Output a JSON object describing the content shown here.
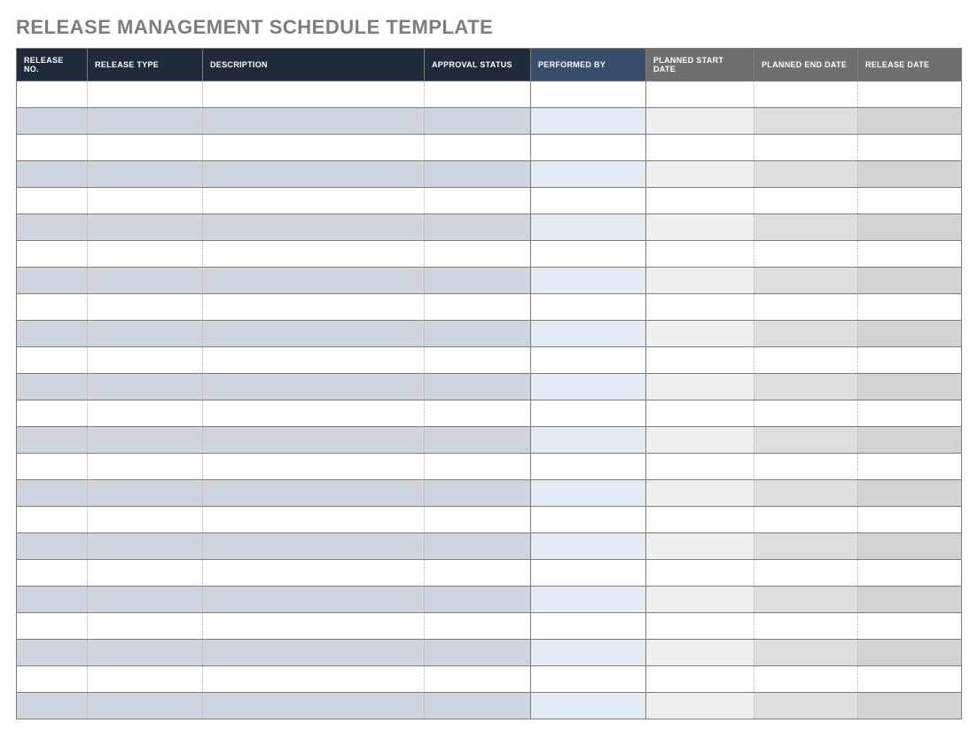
{
  "title": "RELEASE MANAGEMENT SCHEDULE TEMPLATE",
  "columns": [
    "RELEASE NO.",
    "RELEASE TYPE",
    "DESCRIPTION",
    "APPROVAL STATUS",
    "PERFORMED BY",
    "PLANNED START DATE",
    "PLANNED END DATE",
    "RELEASE DATE"
  ],
  "row_count": 24,
  "rows": [
    {
      "release_no": "",
      "release_type": "",
      "description": "",
      "approval_status": "",
      "performed_by": "",
      "planned_start_date": "",
      "planned_end_date": "",
      "release_date": ""
    },
    {
      "release_no": "",
      "release_type": "",
      "description": "",
      "approval_status": "",
      "performed_by": "",
      "planned_start_date": "",
      "planned_end_date": "",
      "release_date": ""
    },
    {
      "release_no": "",
      "release_type": "",
      "description": "",
      "approval_status": "",
      "performed_by": "",
      "planned_start_date": "",
      "planned_end_date": "",
      "release_date": ""
    },
    {
      "release_no": "",
      "release_type": "",
      "description": "",
      "approval_status": "",
      "performed_by": "",
      "planned_start_date": "",
      "planned_end_date": "",
      "release_date": ""
    },
    {
      "release_no": "",
      "release_type": "",
      "description": "",
      "approval_status": "",
      "performed_by": "",
      "planned_start_date": "",
      "planned_end_date": "",
      "release_date": ""
    },
    {
      "release_no": "",
      "release_type": "",
      "description": "",
      "approval_status": "",
      "performed_by": "",
      "planned_start_date": "",
      "planned_end_date": "",
      "release_date": ""
    },
    {
      "release_no": "",
      "release_type": "",
      "description": "",
      "approval_status": "",
      "performed_by": "",
      "planned_start_date": "",
      "planned_end_date": "",
      "release_date": ""
    },
    {
      "release_no": "",
      "release_type": "",
      "description": "",
      "approval_status": "",
      "performed_by": "",
      "planned_start_date": "",
      "planned_end_date": "",
      "release_date": ""
    },
    {
      "release_no": "",
      "release_type": "",
      "description": "",
      "approval_status": "",
      "performed_by": "",
      "planned_start_date": "",
      "planned_end_date": "",
      "release_date": ""
    },
    {
      "release_no": "",
      "release_type": "",
      "description": "",
      "approval_status": "",
      "performed_by": "",
      "planned_start_date": "",
      "planned_end_date": "",
      "release_date": ""
    },
    {
      "release_no": "",
      "release_type": "",
      "description": "",
      "approval_status": "",
      "performed_by": "",
      "planned_start_date": "",
      "planned_end_date": "",
      "release_date": ""
    },
    {
      "release_no": "",
      "release_type": "",
      "description": "",
      "approval_status": "",
      "performed_by": "",
      "planned_start_date": "",
      "planned_end_date": "",
      "release_date": ""
    },
    {
      "release_no": "",
      "release_type": "",
      "description": "",
      "approval_status": "",
      "performed_by": "",
      "planned_start_date": "",
      "planned_end_date": "",
      "release_date": ""
    },
    {
      "release_no": "",
      "release_type": "",
      "description": "",
      "approval_status": "",
      "performed_by": "",
      "planned_start_date": "",
      "planned_end_date": "",
      "release_date": ""
    },
    {
      "release_no": "",
      "release_type": "",
      "description": "",
      "approval_status": "",
      "performed_by": "",
      "planned_start_date": "",
      "planned_end_date": "",
      "release_date": ""
    },
    {
      "release_no": "",
      "release_type": "",
      "description": "",
      "approval_status": "",
      "performed_by": "",
      "planned_start_date": "",
      "planned_end_date": "",
      "release_date": ""
    },
    {
      "release_no": "",
      "release_type": "",
      "description": "",
      "approval_status": "",
      "performed_by": "",
      "planned_start_date": "",
      "planned_end_date": "",
      "release_date": ""
    },
    {
      "release_no": "",
      "release_type": "",
      "description": "",
      "approval_status": "",
      "performed_by": "",
      "planned_start_date": "",
      "planned_end_date": "",
      "release_date": ""
    },
    {
      "release_no": "",
      "release_type": "",
      "description": "",
      "approval_status": "",
      "performed_by": "",
      "planned_start_date": "",
      "planned_end_date": "",
      "release_date": ""
    },
    {
      "release_no": "",
      "release_type": "",
      "description": "",
      "approval_status": "",
      "performed_by": "",
      "planned_start_date": "",
      "planned_end_date": "",
      "release_date": ""
    },
    {
      "release_no": "",
      "release_type": "",
      "description": "",
      "approval_status": "",
      "performed_by": "",
      "planned_start_date": "",
      "planned_end_date": "",
      "release_date": ""
    },
    {
      "release_no": "",
      "release_type": "",
      "description": "",
      "approval_status": "",
      "performed_by": "",
      "planned_start_date": "",
      "planned_end_date": "",
      "release_date": ""
    },
    {
      "release_no": "",
      "release_type": "",
      "description": "",
      "approval_status": "",
      "performed_by": "",
      "planned_start_date": "",
      "planned_end_date": "",
      "release_date": ""
    },
    {
      "release_no": "",
      "release_type": "",
      "description": "",
      "approval_status": "",
      "performed_by": "",
      "planned_start_date": "",
      "planned_end_date": "",
      "release_date": ""
    }
  ]
}
